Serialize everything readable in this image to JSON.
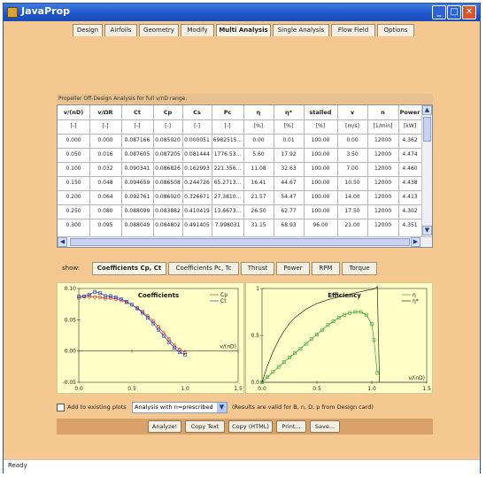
{
  "window": {
    "title": "JavaProp"
  },
  "tabs": [
    "Design",
    "Airfoils",
    "Geometry",
    "Modify",
    "Multi Analysis",
    "Single Analysis",
    "Flow Field",
    "Options"
  ],
  "active_tab": "Multi Analysis",
  "table": {
    "caption": "Propeller Off-Design Analysis for full v/nD range.",
    "headers": [
      "v/(nD)",
      "v/ΩR",
      "Ct",
      "Cp",
      "Cs",
      "Pc",
      "η",
      "η*",
      "stalled",
      "v",
      "n",
      "Power"
    ],
    "units": [
      "[-]",
      "[-]",
      "[-]",
      "[-]",
      "[-]",
      "[-]",
      "[%]",
      "[%]",
      "[%]",
      "[m/s]",
      "[1/min]",
      "[kW]"
    ],
    "rows": [
      [
        "0.000",
        "0.000",
        "0.087166",
        "0.085020",
        "0.000051",
        "6982515...",
        "0.00",
        "0.01",
        "100.00",
        "0.00",
        "12000",
        "4.362"
      ],
      [
        "0.050",
        "0.016",
        "0.087605",
        "0.087205",
        "0.081444",
        "1776.53...",
        "5.60",
        "17.92",
        "100.00",
        "3.50",
        "12000",
        "4.474"
      ],
      [
        "0.100",
        "0.032",
        "0.090341",
        "0.086826",
        "0.162993",
        "221.356...",
        "11.08",
        "32.63",
        "100.00",
        "7.00",
        "12000",
        "4.460"
      ],
      [
        "0.150",
        "0.048",
        "0.094659",
        "0.086508",
        "0.244726",
        "65.2713...",
        "16.41",
        "44.67",
        "100.00",
        "10.50",
        "12000",
        "4.438"
      ],
      [
        "0.200",
        "0.064",
        "0.092761",
        "0.086020",
        "0.326671",
        "27.3810...",
        "21.57",
        "54.47",
        "100.00",
        "14.00",
        "12000",
        "4.413"
      ],
      [
        "0.250",
        "0.080",
        "0.088099",
        "0.083882",
        "0.410419",
        "13.6673...",
        "26.50",
        "62.77",
        "100.00",
        "17.50",
        "12000",
        "4.302"
      ],
      [
        "0.300",
        "0.095",
        "0.088049",
        "0.084802",
        "0.491405",
        "7.998031",
        "31.15",
        "68.93",
        "96.00",
        "21.00",
        "12000",
        "4.351"
      ]
    ]
  },
  "show_label": "show:",
  "plot_tabs": [
    "Coefficients Cp, Ct",
    "Coefficients Pc, Tc",
    "Thrust",
    "Power",
    "RPM",
    "Torque"
  ],
  "active_plot_tab": "Coefficients Cp, Ct",
  "chart_data": [
    {
      "type": "scatter",
      "title": "Coefficients",
      "xlabel": "v/(nD)",
      "ylabel": "",
      "xlim": [
        0,
        1.5
      ],
      "ylim": [
        -0.05,
        0.1
      ],
      "x_ticks": [
        "0.0",
        "0.5",
        "1.0",
        "1.5"
      ],
      "y_ticks": [
        "0.10",
        "0.05",
        "0.00",
        "-0.05"
      ],
      "grid": false,
      "legend_position": "top-right",
      "series": [
        {
          "name": "Cp",
          "color": "#e03030",
          "marker": "circle",
          "x": [
            0.0,
            0.05,
            0.1,
            0.15,
            0.2,
            0.25,
            0.3,
            0.35,
            0.4,
            0.45,
            0.5,
            0.55,
            0.6,
            0.65,
            0.7,
            0.75,
            0.8,
            0.85,
            0.9,
            0.95,
            1.0
          ],
          "y": [
            0.085,
            0.0872,
            0.0868,
            0.0865,
            0.086,
            0.0839,
            0.0848,
            0.083,
            0.081,
            0.078,
            0.074,
            0.069,
            0.063,
            0.056,
            0.048,
            0.039,
            0.029,
            0.019,
            0.009,
            0.002,
            -0.002
          ]
        },
        {
          "name": "Ct",
          "color": "#2040d0",
          "marker": "square",
          "x": [
            0.0,
            0.05,
            0.1,
            0.15,
            0.2,
            0.25,
            0.3,
            0.35,
            0.4,
            0.45,
            0.5,
            0.55,
            0.6,
            0.65,
            0.7,
            0.75,
            0.8,
            0.85,
            0.9,
            0.95,
            1.0
          ],
          "y": [
            0.0872,
            0.0876,
            0.0903,
            0.0947,
            0.0928,
            0.0881,
            0.088,
            0.086,
            0.083,
            0.079,
            0.074,
            0.068,
            0.061,
            0.053,
            0.044,
            0.034,
            0.024,
            0.014,
            0.005,
            -0.002,
            -0.006
          ]
        }
      ]
    },
    {
      "type": "line",
      "title": "Efficiency",
      "xlabel": "v/(nD)",
      "ylabel": "",
      "xlim": [
        0,
        1.5
      ],
      "ylim": [
        0,
        1
      ],
      "x_ticks": [
        "0.0",
        "0.5",
        "1.0",
        "1.5"
      ],
      "y_ticks": [
        "1",
        "0.5",
        "0.0"
      ],
      "grid": false,
      "legend_position": "top-right",
      "series": [
        {
          "name": "η",
          "color": "#30a030",
          "marker": "square",
          "x": [
            0.0,
            0.05,
            0.1,
            0.15,
            0.2,
            0.25,
            0.3,
            0.35,
            0.4,
            0.45,
            0.5,
            0.55,
            0.6,
            0.65,
            0.7,
            0.75,
            0.8,
            0.85,
            0.9,
            0.95,
            1.0,
            1.02,
            1.05
          ],
          "y": [
            0.0,
            0.056,
            0.111,
            0.164,
            0.216,
            0.265,
            0.312,
            0.36,
            0.41,
            0.46,
            0.51,
            0.56,
            0.61,
            0.65,
            0.69,
            0.72,
            0.74,
            0.75,
            0.75,
            0.72,
            0.62,
            0.45,
            0.1
          ]
        },
        {
          "name": "η*",
          "color": "#222222",
          "marker": "none",
          "x": [
            0.0,
            0.05,
            0.1,
            0.15,
            0.2,
            0.25,
            0.3,
            0.4,
            0.5,
            0.6,
            0.7,
            0.8,
            0.9,
            0.95,
            1.0,
            1.03,
            1.05,
            1.07
          ],
          "y": [
            0.0,
            0.179,
            0.326,
            0.447,
            0.545,
            0.628,
            0.689,
            0.78,
            0.84,
            0.88,
            0.91,
            0.94,
            0.965,
            0.98,
            0.99,
            1.0,
            1.02,
            0.0
          ]
        }
      ]
    }
  ],
  "bottom": {
    "add_checkbox_label": "Add to existing plots",
    "mode_select": "Analysis with n=prescribed",
    "validity_note": "(Results are valid for B, n, D, p from Design card)"
  },
  "buttons": [
    "Analyze!",
    "Copy Text",
    "Copy (HTML)",
    "Print...",
    "Save..."
  ],
  "status": "Ready"
}
